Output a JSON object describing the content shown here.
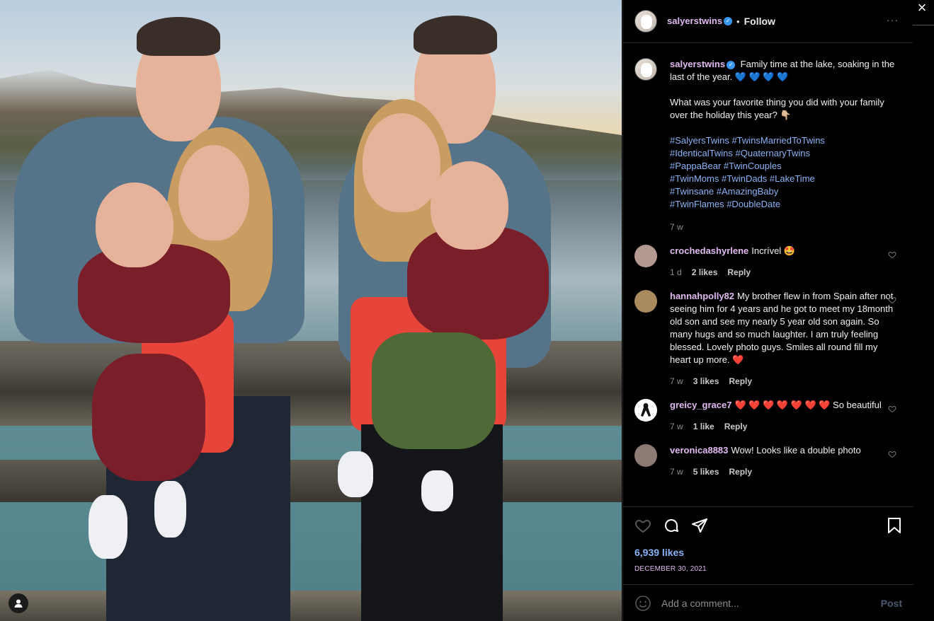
{
  "post": {
    "username": "salyerstwins",
    "follow_label": "Follow",
    "separator": "•",
    "more_label": "···",
    "caption_line1": "Family time at the lake, soaking in the last of the year.",
    "caption_hearts": "💙 💙 💙 💙",
    "caption_question": "What was your favorite thing you did with your family over the holiday this year? 👇🏼",
    "hashtags": [
      "#SalyersTwins",
      "#TwinsMarriedToTwins",
      "#IdenticalTwins",
      "#QuaternaryTwins",
      "#PappaBear",
      "#TwinCouples",
      "#TwinMoms",
      "#TwinDads",
      "#LakeTime",
      "#Twinsane",
      "#AmazingBaby",
      "#TwinFlames",
      "#DoubleDate"
    ],
    "caption_age": "7 w",
    "likes": "6,939 likes",
    "date": "DECEMBER 30, 2021"
  },
  "comments": [
    {
      "username": "crochedashyrlene",
      "text": "Incrível 🤩",
      "age": "1 d",
      "likes": "2 likes",
      "reply": "Reply"
    },
    {
      "username": "hannahpolly82",
      "text": "My brother flew in from Spain after not seeing him for 4 years and he got to meet my 18month old son and see my nearly 5 year old son again. So many hugs and so much laughter. I am truly feeling blessed. Lovely photo guys. Smiles all round fill my heart up more. ❤️",
      "age": "7 w",
      "likes": "3 likes",
      "reply": "Reply"
    },
    {
      "username": "greicy_grace7",
      "text": "❤️ ❤️ ❤️ ❤️ ❤️ ❤️ ❤️ So beautiful",
      "age": "7 w",
      "likes": "1 like",
      "reply": "Reply"
    },
    {
      "username": "veronica8883",
      "text": "Wow! Looks like a double photo",
      "age": "7 w",
      "likes": "5 likes",
      "reply": "Reply"
    }
  ],
  "add_comment": {
    "placeholder": "Add a comment...",
    "post_label": "Post"
  },
  "close_label": "×",
  "icons": {
    "like": "heart-icon",
    "comment": "comment-icon",
    "share": "share-icon",
    "save": "bookmark-icon",
    "emoji": "emoji-icon",
    "user": "user-icon",
    "close": "close-icon"
  }
}
